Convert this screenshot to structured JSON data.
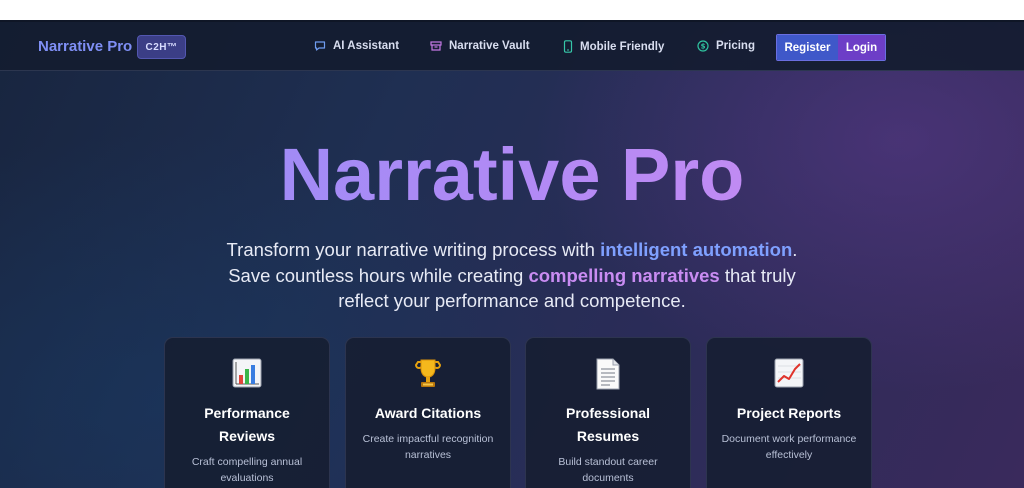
{
  "nav": {
    "brand": "Narrative Pro",
    "badge": "C2H™",
    "items": [
      {
        "label": "AI Assistant",
        "icon": "chat-icon"
      },
      {
        "label": "Narrative Vault",
        "icon": "archive-icon"
      },
      {
        "label": "Mobile Friendly",
        "icon": "mobile-icon"
      },
      {
        "label": "Pricing",
        "icon": "dollar-icon"
      }
    ],
    "register_label": "Register",
    "login_label": "Login"
  },
  "hero": {
    "title": "Narrative Pro",
    "line1_pre": "Transform your narrative writing process with ",
    "line1_hl": "intelligent automation",
    "line1_post": ".",
    "line2_pre": "Save countless hours while creating ",
    "line2_hl": "compelling narratives",
    "line2_post": " that truly",
    "line3": "reflect your performance and competence."
  },
  "cards": [
    {
      "icon": "bar-chart-icon",
      "title": "Performance Reviews",
      "desc": "Craft compelling annual evaluations"
    },
    {
      "icon": "trophy-icon",
      "title": "Award Citations",
      "desc": "Create impactful recognition narratives"
    },
    {
      "icon": "document-icon",
      "title": "Professional Resumes",
      "desc": "Build standout career documents"
    },
    {
      "icon": "trend-chart-icon",
      "title": "Project Reports",
      "desc": "Document work performance effectively"
    }
  ],
  "colors": {
    "accent_blue": "#7fa0ff",
    "accent_purple": "#c98cf2",
    "register_bg": "#3f58c9",
    "login_bg": "#6d3ec7"
  }
}
